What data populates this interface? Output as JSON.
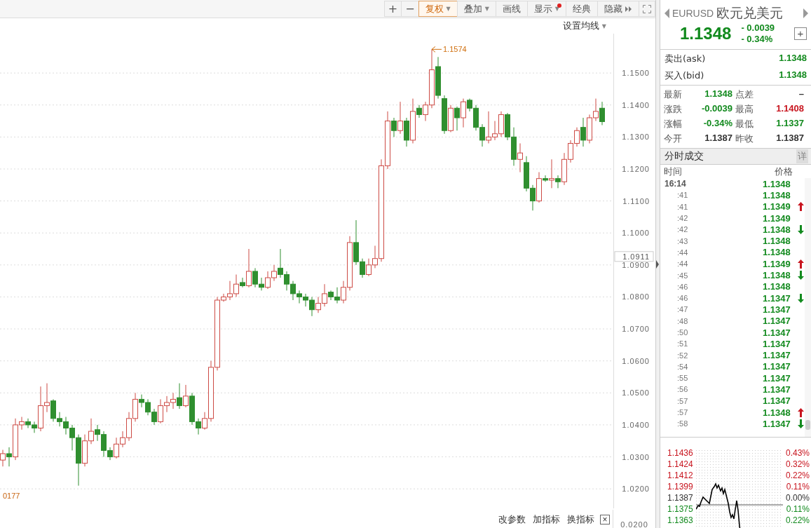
{
  "toolbar": {
    "buttons": [
      {
        "label": "+",
        "kind": "icon",
        "selected": false,
        "alert": false
      },
      {
        "label": "−",
        "kind": "icon",
        "selected": false,
        "alert": false
      },
      {
        "label": "复权",
        "kind": "text",
        "selected": true,
        "alert": false,
        "caret": "▼"
      },
      {
        "label": "叠加",
        "kind": "text",
        "selected": false,
        "alert": false,
        "caret": "▼"
      },
      {
        "label": "画线",
        "kind": "text",
        "selected": false,
        "alert": false
      },
      {
        "label": "显示",
        "kind": "text",
        "selected": false,
        "alert": true,
        "caret": "▼"
      },
      {
        "label": "经典",
        "kind": "text",
        "selected": false,
        "alert": false
      },
      {
        "label": "隐藏",
        "kind": "more",
        "selected": false,
        "alert": false
      },
      {
        "kind": "fullscreen",
        "selected": false,
        "alert": false
      }
    ]
  },
  "ma_setting": {
    "label": "设置均线",
    "caret": "▼"
  },
  "chart": {
    "current_price": "1.0911",
    "peak_label": "1.1574",
    "low_label": "0177",
    "chart_data": {
      "type": "candlestick",
      "ylim": [
        1.0139,
        1.1623
      ],
      "grid": true,
      "yticks": [
        {
          "value": 1.15,
          "label": "1.1500"
        },
        {
          "value": 1.14,
          "label": "1.1400"
        },
        {
          "value": 1.13,
          "label": "1.1300"
        },
        {
          "value": 1.12,
          "label": "1.1200"
        },
        {
          "value": 1.11,
          "label": "1.1100"
        },
        {
          "value": 1.1,
          "label": "1.1000"
        },
        {
          "value": 1.09,
          "label": "1.0900"
        },
        {
          "value": 1.08,
          "label": "1.0800"
        },
        {
          "value": 1.07,
          "label": "1.0700"
        },
        {
          "value": 1.06,
          "label": "1.0600"
        },
        {
          "value": 1.05,
          "label": "1.0500"
        },
        {
          "value": 1.04,
          "label": "1.0400"
        },
        {
          "value": 1.03,
          "label": "1.0300"
        },
        {
          "value": 1.02,
          "label": "1.0200"
        }
      ],
      "ohlc": [
        [
          1.029,
          1.0322,
          1.027,
          1.031
        ],
        [
          1.031,
          1.033,
          1.027,
          1.03
        ],
        [
          1.03,
          1.042,
          1.029,
          1.04
        ],
        [
          1.04,
          1.0425,
          1.0385,
          1.041
        ],
        [
          1.041,
          1.042,
          1.039,
          1.04
        ],
        [
          1.04,
          1.041,
          1.0375,
          1.039
        ],
        [
          1.039,
          1.052,
          1.038,
          1.046
        ],
        [
          1.046,
          1.053,
          1.044,
          1.047
        ],
        [
          1.0475,
          1.048,
          1.041,
          1.042
        ],
        [
          1.042,
          1.044,
          1.0395,
          1.041
        ],
        [
          1.041,
          1.0425,
          1.037,
          1.039
        ],
        [
          1.039,
          1.04,
          1.032,
          1.036
        ],
        [
          1.036,
          1.037,
          1.021,
          1.028
        ],
        [
          1.028,
          1.037,
          1.027,
          1.035
        ],
        [
          1.035,
          1.042,
          1.034,
          1.038
        ],
        [
          1.0385,
          1.04,
          1.035,
          1.037
        ],
        [
          1.037,
          1.038,
          1.03,
          1.032
        ],
        [
          1.032,
          1.033,
          1.029,
          1.03
        ],
        [
          1.03,
          1.036,
          1.0295,
          1.034
        ],
        [
          1.034,
          1.038,
          1.033,
          1.036
        ],
        [
          1.036,
          1.044,
          1.035,
          1.042
        ],
        [
          1.042,
          1.05,
          1.041,
          1.048
        ],
        [
          1.048,
          1.0495,
          1.0455,
          1.047
        ],
        [
          1.047,
          1.048,
          1.043,
          1.044
        ],
        [
          1.044,
          1.045,
          1.04,
          1.041
        ],
        [
          1.041,
          1.048,
          1.0405,
          1.046
        ],
        [
          1.046,
          1.049,
          1.044,
          1.047
        ],
        [
          1.047,
          1.05,
          1.045,
          1.048
        ],
        [
          1.0485,
          1.053,
          1.045,
          1.046
        ],
        [
          1.046,
          1.0525,
          1.0455,
          1.049
        ],
        [
          1.049,
          1.05,
          1.04,
          1.041
        ],
        [
          1.041,
          1.042,
          1.037,
          1.039
        ],
        [
          1.039,
          1.044,
          1.0385,
          1.042
        ],
        [
          1.042,
          1.06,
          1.041,
          1.058
        ],
        [
          1.058,
          1.08,
          1.057,
          1.079
        ],
        [
          1.079,
          1.081,
          1.0785,
          1.08
        ],
        [
          1.08,
          1.085,
          1.079,
          1.081
        ],
        [
          1.081,
          1.087,
          1.08,
          1.084
        ],
        [
          1.0845,
          1.086,
          1.083,
          1.0835
        ],
        [
          1.0835,
          1.095,
          1.083,
          1.088
        ],
        [
          1.088,
          1.089,
          1.083,
          1.084
        ],
        [
          1.084,
          1.086,
          1.082,
          1.083
        ],
        [
          1.083,
          1.088,
          1.0825,
          1.086
        ],
        [
          1.086,
          1.09,
          1.085,
          1.088
        ],
        [
          1.089,
          1.095,
          1.086,
          1.087
        ],
        [
          1.087,
          1.088,
          1.082,
          1.084
        ],
        [
          1.084,
          1.085,
          1.079,
          1.081
        ],
        [
          1.081,
          1.082,
          1.078,
          1.08
        ],
        [
          1.08,
          1.081,
          1.077,
          1.079
        ],
        [
          1.079,
          1.08,
          1.074,
          1.076
        ],
        [
          1.076,
          1.08,
          1.075,
          1.078
        ],
        [
          1.078,
          1.084,
          1.077,
          1.081
        ],
        [
          1.0815,
          1.082,
          1.079,
          1.08
        ],
        [
          1.08,
          1.083,
          1.078,
          1.079
        ],
        [
          1.079,
          1.085,
          1.078,
          1.083
        ],
        [
          1.083,
          1.099,
          1.082,
          1.097
        ],
        [
          1.097,
          1.104,
          1.09,
          1.091
        ],
        [
          1.091,
          1.092,
          1.086,
          1.087
        ],
        [
          1.087,
          1.092,
          1.0865,
          1.09
        ],
        [
          1.09,
          1.096,
          1.089,
          1.092
        ],
        [
          1.092,
          1.123,
          1.091,
          1.121
        ],
        [
          1.121,
          1.138,
          1.12,
          1.135
        ],
        [
          1.135,
          1.136,
          1.13,
          1.132
        ],
        [
          1.132,
          1.141,
          1.131,
          1.135
        ],
        [
          1.135,
          1.136,
          1.127,
          1.129
        ],
        [
          1.129,
          1.142,
          1.128,
          1.138
        ],
        [
          1.139,
          1.14,
          1.136,
          1.137
        ],
        [
          1.137,
          1.141,
          1.135,
          1.14
        ],
        [
          1.14,
          1.1574,
          1.139,
          1.151
        ],
        [
          1.152,
          1.155,
          1.142,
          1.143
        ],
        [
          1.142,
          1.143,
          1.131,
          1.132
        ],
        [
          1.132,
          1.14,
          1.1315,
          1.139
        ],
        [
          1.139,
          1.1395,
          1.132,
          1.136
        ],
        [
          1.136,
          1.142,
          1.133,
          1.141
        ],
        [
          1.1415,
          1.142,
          1.138,
          1.139
        ],
        [
          1.139,
          1.14,
          1.132,
          1.133
        ],
        [
          1.133,
          1.134,
          1.127,
          1.129
        ],
        [
          1.129,
          1.138,
          1.128,
          1.13
        ],
        [
          1.13,
          1.135,
          1.129,
          1.131
        ],
        [
          1.131,
          1.138,
          1.13,
          1.137
        ],
        [
          1.137,
          1.1375,
          1.129,
          1.13
        ],
        [
          1.13,
          1.133,
          1.121,
          1.123
        ],
        [
          1.123,
          1.128,
          1.119,
          1.125
        ],
        [
          1.122,
          1.124,
          1.113,
          1.114
        ],
        [
          1.114,
          1.115,
          1.107,
          1.11
        ],
        [
          1.11,
          1.119,
          1.1095,
          1.117
        ],
        [
          1.117,
          1.118,
          1.116,
          1.1165
        ],
        [
          1.1165,
          1.123,
          1.114,
          1.117
        ],
        [
          1.117,
          1.118,
          1.114,
          1.116
        ],
        [
          1.116,
          1.125,
          1.115,
          1.123
        ],
        [
          1.123,
          1.129,
          1.122,
          1.128
        ],
        [
          1.128,
          1.133,
          1.127,
          1.132
        ],
        [
          1.133,
          1.136,
          1.127,
          1.129
        ],
        [
          1.129,
          1.137,
          1.128,
          1.136
        ],
        [
          1.136,
          1.142,
          1.135,
          1.138
        ],
        [
          1.139,
          1.141,
          1.1337,
          1.1348
        ]
      ]
    }
  },
  "indicator_bar": {
    "buttons": [
      "改参数",
      "加指标",
      "换指标"
    ],
    "close": "×",
    "axis_label": "0.0200"
  },
  "quote": {
    "symbol": "EURUSD",
    "name": "欧元兑美元",
    "price": "1.1348",
    "change": "- 0.0039",
    "change_pct": "- 0.34%",
    "add": "+",
    "ask": {
      "label": "卖出(ask)",
      "value": "1.1348"
    },
    "bid": {
      "label": "买入(bid)",
      "value": "1.1348"
    },
    "stats": [
      {
        "label": "最新",
        "value": "1.1348",
        "color": "#128a1e"
      },
      {
        "label": "点差",
        "value": "–",
        "color": "#333333"
      },
      {
        "label": "涨跌",
        "value": "-0.0039",
        "color": "#128a1e"
      },
      {
        "label": "最高",
        "value": "1.1408",
        "color": "#c8141e"
      },
      {
        "label": "涨幅",
        "value": "-0.34%",
        "color": "#128a1e"
      },
      {
        "label": "最低",
        "value": "1.1337",
        "color": "#128a1e"
      },
      {
        "label": "今开",
        "value": "1.1387",
        "color": "#333333"
      },
      {
        "label": "昨收",
        "value": "1.1387",
        "color": "#333333"
      }
    ]
  },
  "trades": {
    "title": "分时成交",
    "detail": "详",
    "columns": [
      "时间",
      "价格"
    ],
    "rows": [
      {
        "time": "16:14",
        "price": "1.1348",
        "kind": "plain"
      },
      {
        "time": ":41",
        "price": "1.1348",
        "kind": "plain"
      },
      {
        "time": ":41",
        "price": "1.1349",
        "kind": "up"
      },
      {
        "time": ":42",
        "price": "1.1349",
        "kind": "plain"
      },
      {
        "time": ":42",
        "price": "1.1348",
        "kind": "down"
      },
      {
        "time": ":43",
        "price": "1.1348",
        "kind": "plain"
      },
      {
        "time": ":44",
        "price": "1.1348",
        "kind": "plain"
      },
      {
        "time": ":44",
        "price": "1.1349",
        "kind": "up"
      },
      {
        "time": ":45",
        "price": "1.1348",
        "kind": "down"
      },
      {
        "time": ":46",
        "price": "1.1348",
        "kind": "plain"
      },
      {
        "time": ":46",
        "price": "1.1347",
        "kind": "down"
      },
      {
        "time": ":47",
        "price": "1.1347",
        "kind": "plain"
      },
      {
        "time": ":48",
        "price": "1.1347",
        "kind": "plain"
      },
      {
        "time": ":50",
        "price": "1.1347",
        "kind": "plain"
      },
      {
        "time": ":51",
        "price": "1.1347",
        "kind": "plain"
      },
      {
        "time": ":52",
        "price": "1.1347",
        "kind": "plain"
      },
      {
        "time": ":54",
        "price": "1.1347",
        "kind": "plain"
      },
      {
        "time": ":55",
        "price": "1.1347",
        "kind": "plain"
      },
      {
        "time": ":56",
        "price": "1.1347",
        "kind": "plain"
      },
      {
        "time": ":57",
        "price": "1.1347",
        "kind": "plain"
      },
      {
        "time": ":57",
        "price": "1.1348",
        "kind": "up"
      },
      {
        "time": ":58",
        "price": "1.1347",
        "kind": "down"
      }
    ]
  },
  "mini_chart": {
    "rows": [
      {
        "price": "1.1436",
        "pct": "0.43%",
        "color": "#c8141e"
      },
      {
        "price": "1.1424",
        "pct": "0.32%",
        "color": "#c8141e"
      },
      {
        "price": "1.1412",
        "pct": "0.22%",
        "color": "#c8141e"
      },
      {
        "price": "1.1399",
        "pct": "0.11%",
        "color": "#c8141e"
      },
      {
        "price": "1.1387",
        "pct": "0.00%",
        "color": "#333333"
      },
      {
        "price": "1.1375",
        "pct": "0.11%",
        "color": "#128a1e"
      },
      {
        "price": "1.1363",
        "pct": "0.22%",
        "color": "#128a1e"
      }
    ]
  }
}
